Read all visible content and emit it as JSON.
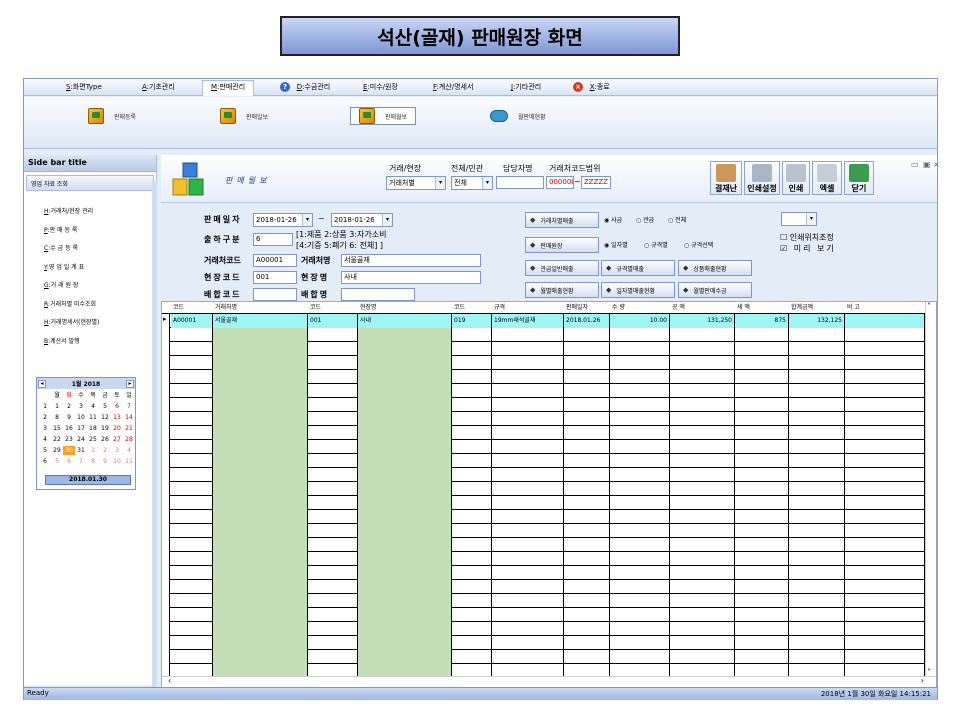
{
  "slide_title": "석산(골재) 판매원장 화면",
  "menu": [
    {
      "key": "S",
      "label": ":화면Type"
    },
    {
      "key": "A",
      "label": ":기초관리"
    },
    {
      "key": "M",
      "label": ":판매관리"
    },
    {
      "key": "D",
      "label": ":수금관리"
    },
    {
      "key": "E",
      "label": ":미수/원장"
    },
    {
      "key": "F",
      "label": ":계산/명세서"
    },
    {
      "key": "J",
      "label": ":기타관리"
    },
    {
      "key": "X",
      "label": ":종료"
    }
  ],
  "ribbon": [
    "판매등록",
    "판매일보",
    "판매월보",
    "월판매현황"
  ],
  "sidebar": {
    "title": "Side bar title",
    "section": "영업 자료 조회",
    "items": [
      {
        "key": "H",
        "label": ":거래처/현장 관리"
      },
      {
        "key": "P",
        "label": ":판 매 등 록"
      },
      {
        "key": "C",
        "label": ":수 금 등 록"
      },
      {
        "key": "Y",
        "label": ":영 업 일 계 표"
      },
      {
        "key": "G",
        "label": ":거 래 원 장"
      },
      {
        "key": "R",
        "label": ":거래처별 미수조회"
      },
      {
        "key": "H",
        "label": ":거래명세서(현장별)"
      },
      {
        "key": "B",
        "label": ":계산서 발행"
      }
    ]
  },
  "calendar": {
    "title": "1월 2018",
    "weekdays": [
      "월",
      "화",
      "수",
      "목",
      "금",
      "토",
      "일"
    ],
    "weeks": [
      {
        "no": "1",
        "days": [
          "1",
          "2",
          "3",
          "4",
          "5",
          "6",
          "7"
        ]
      },
      {
        "no": "2",
        "days": [
          "8",
          "9",
          "10",
          "11",
          "12",
          "13",
          "14"
        ]
      },
      {
        "no": "3",
        "days": [
          "15",
          "16",
          "17",
          "18",
          "19",
          "20",
          "21"
        ]
      },
      {
        "no": "4",
        "days": [
          "22",
          "23",
          "24",
          "25",
          "26",
          "27",
          "28"
        ]
      },
      {
        "no": "5",
        "days": [
          "29",
          "30",
          "31",
          "1",
          "2",
          "3",
          "4"
        ]
      },
      {
        "no": "6",
        "days": [
          "5",
          "6",
          "7",
          "8",
          "9",
          "10",
          "11"
        ]
      }
    ],
    "today": "2018.01.30"
  },
  "header": {
    "sheet_title": "판매월보",
    "labels": {
      "site": "거래/현장",
      "public": "전체/민관",
      "manager": "담당자명",
      "code_range": "거래처코드범위"
    },
    "site_value": "거래처별",
    "public_value": "전체",
    "range_from": "000000",
    "range_sep": "~",
    "range_to": "ZZZZZ",
    "toolbar": [
      "결재난",
      "인쇄설정",
      "인쇄",
      "엑셀",
      "닫기"
    ]
  },
  "form": {
    "date_label": "판매일자",
    "date_from": "2018-01-26",
    "date_sep": "~",
    "date_to": "2018-01-26",
    "type_label": "출하구분",
    "type_value": "6",
    "type_hint1": "[1:제품 2:상품 3:자가소비",
    "type_hint2": "[4:기증 5:폐기 6: 전체] ]",
    "client_code_label": "거래처코드",
    "client_code": "A00001",
    "client_name_label": "거래처명",
    "client_name": "서울골재",
    "site_code_label": "현장코드",
    "site_code": "001",
    "site_name_label": "현장명",
    "site_name": "사내",
    "assoc_code_label": "배합코드",
    "assoc_name_label": "배합명",
    "buttons": [
      "거래처별매출",
      "판매원장",
      "관급일반매출",
      "규격별매출",
      "상품매출현황",
      "월별매출현황",
      "일자별매출현황",
      "월별판매수금"
    ],
    "radio_group1": [
      "사급",
      "관급",
      "전체"
    ],
    "radio_group2": [
      "일자별",
      "규격별",
      "규격선택"
    ],
    "check_print": "인쇄위치조정",
    "check_preview": "미리 보기"
  },
  "grid": {
    "headers": [
      "코드",
      "거래처명",
      "코드",
      "현장명",
      "코드",
      "규격",
      "판매일자",
      "수 량",
      "공 액",
      "세 액",
      "합계금액",
      "비 고"
    ],
    "rows": [
      [
        "A00001",
        "서울골재",
        "001",
        "사내",
        "019",
        "19mm쇄석골재",
        "2018.01.26",
        "10.00",
        "131,250",
        "875",
        "132,125",
        ""
      ]
    ]
  },
  "status": {
    "left": "Ready",
    "right": "2018년 1월 30일 화요일 14:15:21"
  },
  "colors": {
    "row_highlight": "#9ff5f4",
    "green_col": "#c4deb8",
    "accent": "#1b3d8f"
  }
}
